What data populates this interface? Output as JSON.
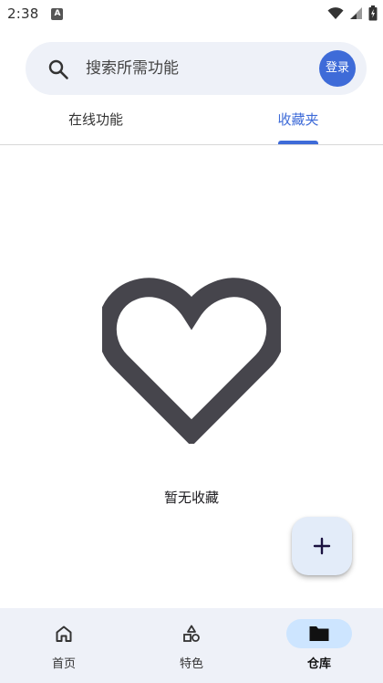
{
  "status_bar": {
    "time": "2:38",
    "notification_icon": "A",
    "icons": [
      "wifi-icon",
      "signal-icon",
      "battery-icon"
    ]
  },
  "search": {
    "placeholder": "搜索所需功能",
    "login_label": "登录"
  },
  "tabs": [
    {
      "label": "在线功能",
      "selected": false
    },
    {
      "label": "收藏夹",
      "selected": true
    }
  ],
  "empty_state": {
    "icon": "heart-outline-icon",
    "message": "暂无收藏"
  },
  "fab": {
    "icon": "plus-icon"
  },
  "bottom_nav": [
    {
      "label": "首页",
      "icon": "home-icon",
      "selected": false
    },
    {
      "label": "特色",
      "icon": "shapes-icon",
      "selected": false
    },
    {
      "label": "仓库",
      "icon": "folder-icon",
      "selected": true
    }
  ],
  "colors": {
    "accent": "#3e6bd8",
    "surface": "#eef1f8",
    "nav_indicator": "#cde5ff",
    "fab_bg": "#e3ecf9"
  }
}
